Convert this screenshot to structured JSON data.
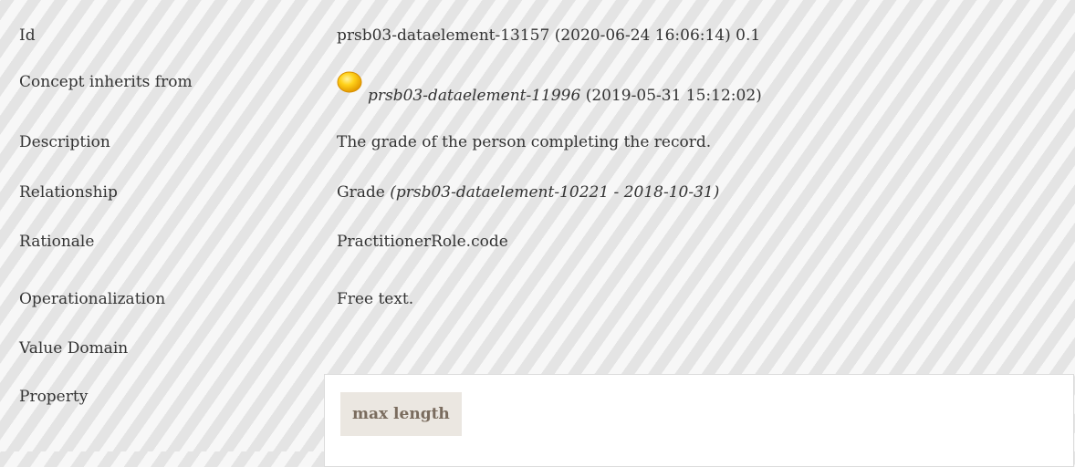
{
  "rows": {
    "id": {
      "label": "Id",
      "value": "prsb03-dataelement-13157 (2020-06-24 16:06:14) 0.1"
    },
    "inherits": {
      "label": "Concept inherits from",
      "ref": "prsb03-dataelement-11996",
      "date": " (2019-05-31 15:12:02)",
      "icon": "yellow-circle-icon"
    },
    "description": {
      "label": "Description",
      "value": "The grade of the person completing the record."
    },
    "relationship": {
      "label": "Relationship",
      "name": "Grade",
      "ref": "(prsb03-dataelement-10221 - 2018-10-31)"
    },
    "rationale": {
      "label": "Rationale",
      "value": "PractitionerRole.code"
    },
    "operationalization": {
      "label": "Operationalization",
      "value": "Free text."
    },
    "value_domain": {
      "label": "Value Domain"
    },
    "property": {
      "label": "Property",
      "tag": "max length"
    }
  },
  "colors": {
    "text": "#333333",
    "tag_background": "#ebe7e1",
    "tag_text": "#7a6c5e",
    "icon_fill": "#f7b500"
  }
}
